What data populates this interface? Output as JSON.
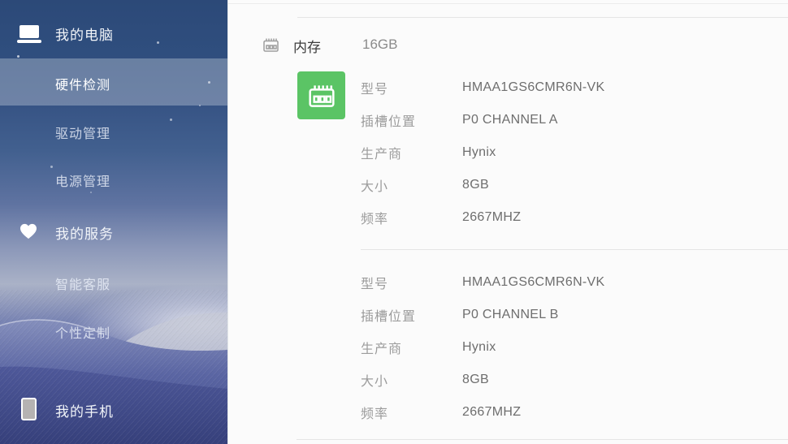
{
  "sidebar": {
    "groups": [
      {
        "icon": "laptop-icon",
        "label": "我的电脑",
        "items": [
          {
            "label": "硬件检测",
            "selected": true
          },
          {
            "label": "驱动管理",
            "selected": false
          },
          {
            "label": "电源管理",
            "selected": false
          }
        ]
      },
      {
        "icon": "heart-icon",
        "label": "我的服务",
        "items": [
          {
            "label": "智能客服",
            "selected": false
          },
          {
            "label": "个性定制",
            "selected": false
          }
        ]
      },
      {
        "icon": "phone-icon",
        "label": "我的手机",
        "items": []
      }
    ]
  },
  "main": {
    "section": {
      "icon": "ram-icon",
      "label": "内存",
      "value": "16GB"
    },
    "modules": [
      {
        "icon": "ram-module-icon",
        "rows": [
          {
            "label": "型号",
            "value": "HMAA1GS6CMR6N-VK"
          },
          {
            "label": "插槽位置",
            "value": "P0 CHANNEL A"
          },
          {
            "label": "生产商",
            "value": "Hynix"
          },
          {
            "label": "大小",
            "value": "8GB"
          },
          {
            "label": "频率",
            "value": "2667MHZ"
          }
        ]
      },
      {
        "rows": [
          {
            "label": "型号",
            "value": "HMAA1GS6CMR6N-VK"
          },
          {
            "label": "插槽位置",
            "value": "P0 CHANNEL B"
          },
          {
            "label": "生产商",
            "value": "Hynix"
          },
          {
            "label": "大小",
            "value": "8GB"
          },
          {
            "label": "频率",
            "value": "2667MHZ"
          }
        ]
      }
    ]
  },
  "colors": {
    "accent_green": "#5bc465",
    "sidebar_top": "#2c4978",
    "sidebar_selected_overlay": "rgba(255,255,255,0.28)",
    "divider": "#e5e5e5",
    "label_gray": "#9c9c9c",
    "value_gray": "#6e6e6e"
  }
}
